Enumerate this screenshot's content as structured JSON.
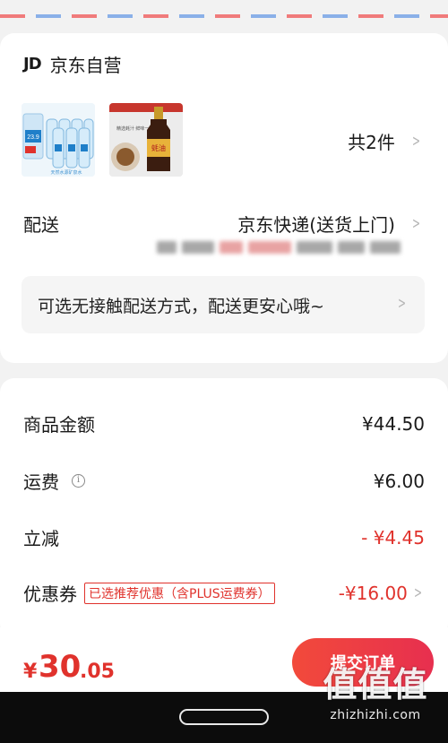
{
  "store": {
    "logo_text": "JD",
    "name": "京东自营"
  },
  "products": {
    "count_label": "共2件",
    "items": [
      {
        "icon": "water-bottles-image",
        "price_tag": "23.9",
        "caption": "天然水源矿泉水"
      },
      {
        "icon": "soy-sauce-image",
        "label": "蚝油",
        "tagline": "精选蚝汁 鲜味一瓶"
      }
    ]
  },
  "delivery": {
    "label": "配送",
    "method": "京东快递(送货上门)",
    "notice": "可选无接触配送方式，配送更安心哦~"
  },
  "summary": {
    "goods_label": "商品金额",
    "goods_value": "¥44.50",
    "shipping_label": "运费",
    "shipping_value": "¥6.00",
    "discount_label": "立减",
    "discount_value": "- ¥4.45",
    "coupon_label": "优惠券",
    "coupon_tag": "已选推荐优惠（含PLUS运费券）",
    "coupon_value": "-¥16.00"
  },
  "checkout": {
    "currency": "¥",
    "total_int": "30",
    "total_dec": ".05",
    "submit_label": "提交订单"
  },
  "watermark": {
    "big": "值值值",
    "small": "zhizhizhi.com"
  },
  "colors": {
    "accent": "#e0322c",
    "button_start": "#f24a3b",
    "button_end": "#e72f4f"
  }
}
